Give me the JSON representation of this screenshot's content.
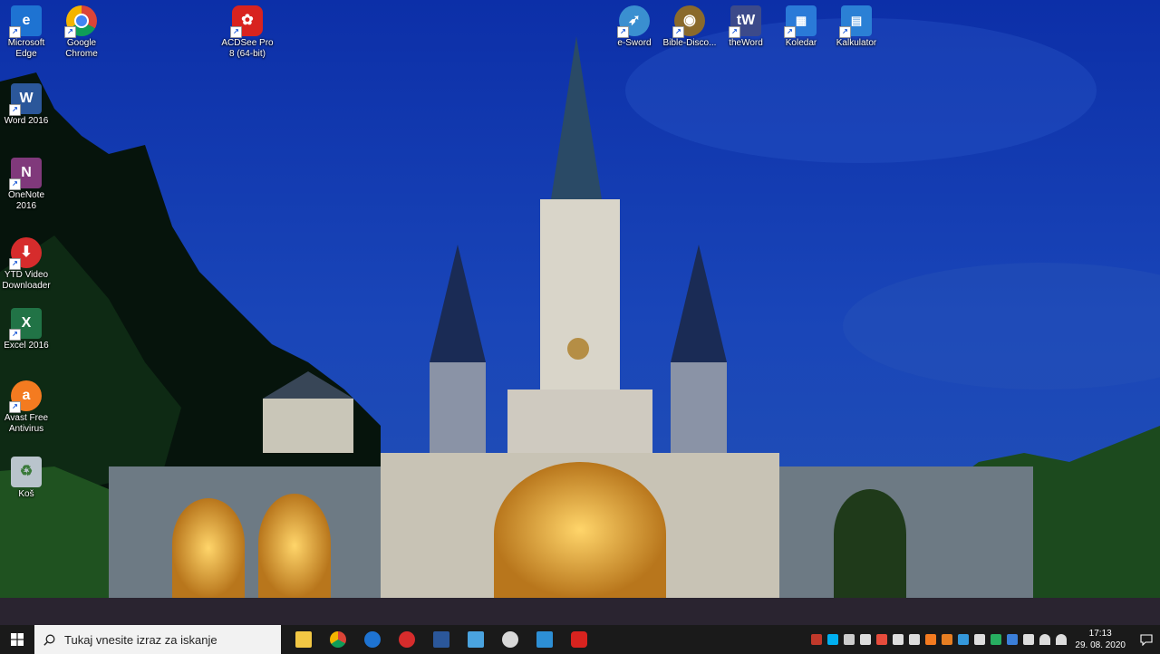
{
  "desktop": {
    "icons": [
      {
        "label": "Microsoft Edge",
        "icon": "edge-icon",
        "color": "#1e73d2"
      },
      {
        "label": "Google Chrome",
        "icon": "chrome-icon",
        "color": "#ffffff"
      },
      {
        "label": "ACDSee Pro 8 (64-bit)",
        "icon": "acdsee-icon",
        "color": "#d8231f"
      },
      {
        "label": "e-Sword",
        "icon": "esword-icon",
        "color": "#3a8fd0"
      },
      {
        "label": "Bible-Disco...",
        "icon": "bible-discovery-icon",
        "color": "#8a6a2c"
      },
      {
        "label": "theWord",
        "icon": "theword-icon",
        "color": "#3c4a8a"
      },
      {
        "label": "Koledar",
        "icon": "calendar-icon",
        "color": "#2a7ad8"
      },
      {
        "label": "Kalkulator",
        "icon": "calculator-icon",
        "color": "#2b80d5"
      },
      {
        "label": "Word 2016",
        "icon": "word-icon",
        "color": "#2b579a"
      },
      {
        "label": "OneNote 2016",
        "icon": "onenote-icon",
        "color": "#80397b"
      },
      {
        "label": "YTD Video Downloader",
        "icon": "ytd-icon",
        "color": "#d62c2c"
      },
      {
        "label": "Excel 2016",
        "icon": "excel-icon",
        "color": "#217346"
      },
      {
        "label": "Avast Free Antivirus",
        "icon": "avast-icon",
        "color": "#f47b20"
      },
      {
        "label": "Koš",
        "icon": "recycle-bin-icon",
        "color": "#b9c4cc"
      }
    ]
  },
  "taskbar": {
    "search_placeholder": "Tukaj vnesite izraz za iskanje",
    "apps": [
      {
        "icon": "file-explorer-icon",
        "color": "#f2c744"
      },
      {
        "icon": "chrome-icon",
        "color": "#ffffff"
      },
      {
        "icon": "edge-icon",
        "color": "#1e73d2"
      },
      {
        "icon": "ytd-icon",
        "color": "#d62c2c"
      },
      {
        "icon": "word-icon",
        "color": "#2b579a"
      },
      {
        "icon": "laptop-app-icon",
        "color": "#4aa3df"
      },
      {
        "icon": "app-icon",
        "color": "#d8d8d8"
      },
      {
        "icon": "photos-icon",
        "color": "#2d8fd5"
      },
      {
        "icon": "acdsee-icon",
        "color": "#d8231f"
      }
    ],
    "tray": {
      "icons": [
        {
          "icon": "tray-app-icon",
          "color": "#c0392b"
        },
        {
          "icon": "skype-icon",
          "color": "#00aff0"
        },
        {
          "icon": "network-off-icon",
          "color": "#cccccc"
        },
        {
          "icon": "app-tray-icon",
          "color": "#dddddd"
        },
        {
          "icon": "record-icon",
          "color": "#e74c3c"
        },
        {
          "icon": "usb-icon",
          "color": "#dddddd"
        },
        {
          "icon": "info-icon",
          "color": "#dddddd"
        },
        {
          "icon": "avast-icon",
          "color": "#f47b20"
        },
        {
          "icon": "app-icon",
          "color": "#e67e22"
        },
        {
          "icon": "display-icon",
          "color": "#3498db"
        },
        {
          "icon": "keyboard-icon",
          "color": "#dddddd"
        },
        {
          "icon": "chat-icon",
          "color": "#27ae60"
        },
        {
          "icon": "bluetooth-icon",
          "color": "#3b7fd9"
        },
        {
          "icon": "power-icon",
          "color": "#dddddd"
        },
        {
          "icon": "wifi-icon",
          "color": "#ffffff"
        },
        {
          "icon": "volume-icon",
          "color": "#ffffff"
        }
      ],
      "time": "17:13",
      "date": "29. 08. 2020"
    }
  }
}
